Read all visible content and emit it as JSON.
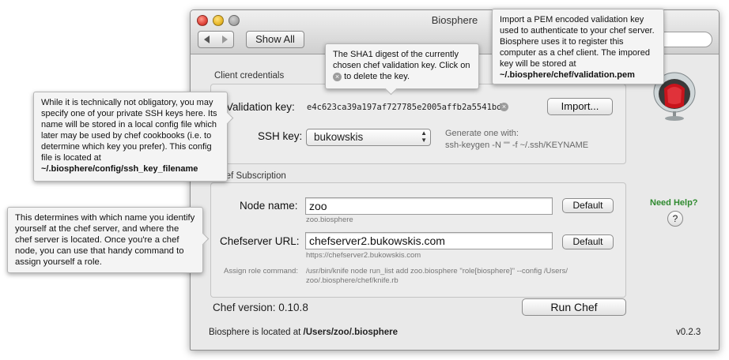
{
  "window": {
    "title": "Biosphere",
    "toolbar": {
      "show_all_label": "Show All"
    }
  },
  "client_credentials": {
    "section_label": "Client credentials",
    "validation_key_label": "Validation key:",
    "validation_key_value": "e4c623ca39a197af727785e2005affb2a5541bda",
    "import_button": "Import...",
    "ssh_key_label": "SSH key:",
    "ssh_key_selected": "bukowskis",
    "generate_hint_line1": "Generate one with:",
    "generate_hint_line2": "ssh-keygen -N \"\" -f ~/.ssh/KEYNAME"
  },
  "chef_subscription": {
    "section_label": "Chef Subscription",
    "node_name_label": "Node name:",
    "node_name_value": "zoo",
    "node_name_hint": "zoo.biosphere",
    "default_button": "Default",
    "chefserver_url_label": "Chefserver URL:",
    "chefserver_url_value": "chefserver2.bukowskis.com",
    "chefserver_url_hint": "https://chefserver2.bukowskis.com",
    "assign_role_label": "Assign role command:",
    "assign_role_line1": "/usr/bin/knife node run_list add zoo.biosphere \"role[biosphere]\" --config /Users/",
    "assign_role_line2": "zoo/.biosphere/chef/knife.rb"
  },
  "footer": {
    "chef_version": "Chef version: 0.10.8",
    "run_chef_button": "Run Chef",
    "located_prefix": "Biosphere is located at ",
    "located_path": "/Users/zoo/.biosphere",
    "version": "v0.2.3"
  },
  "help": {
    "label": "Need Help?",
    "icon_text": "?"
  },
  "tooltips": {
    "import": {
      "text": "Import a PEM encoded validation key used to authenticate to your chef server. Biosphere uses it to register this computer as a chef client. The impored key will be stored at",
      "path": "~/.biosphere/chef/validation.pem"
    },
    "sha1": {
      "text_before": "The SHA1 digest of the currently chosen chef validation key. Click on",
      "text_after": "to delete the key."
    },
    "ssh": {
      "text": "While it is technically not obligatory, you may specify one of your private SSH keys here. Its name will be stored in a local config file which later may be used by chef cookbooks (i.e. to determine which key you prefer). This config file is located at",
      "path": "~/.biosphere/config/ssh_key_filename"
    },
    "node": {
      "text": "This determines with which name you identify yourself at the chef server, and where the chef server is located. Once you're a chef node, you can use that handy command to assign yourself a role."
    }
  },
  "colors": {
    "help_green": "#2f8a2f",
    "chair_red": "#c8141c"
  }
}
